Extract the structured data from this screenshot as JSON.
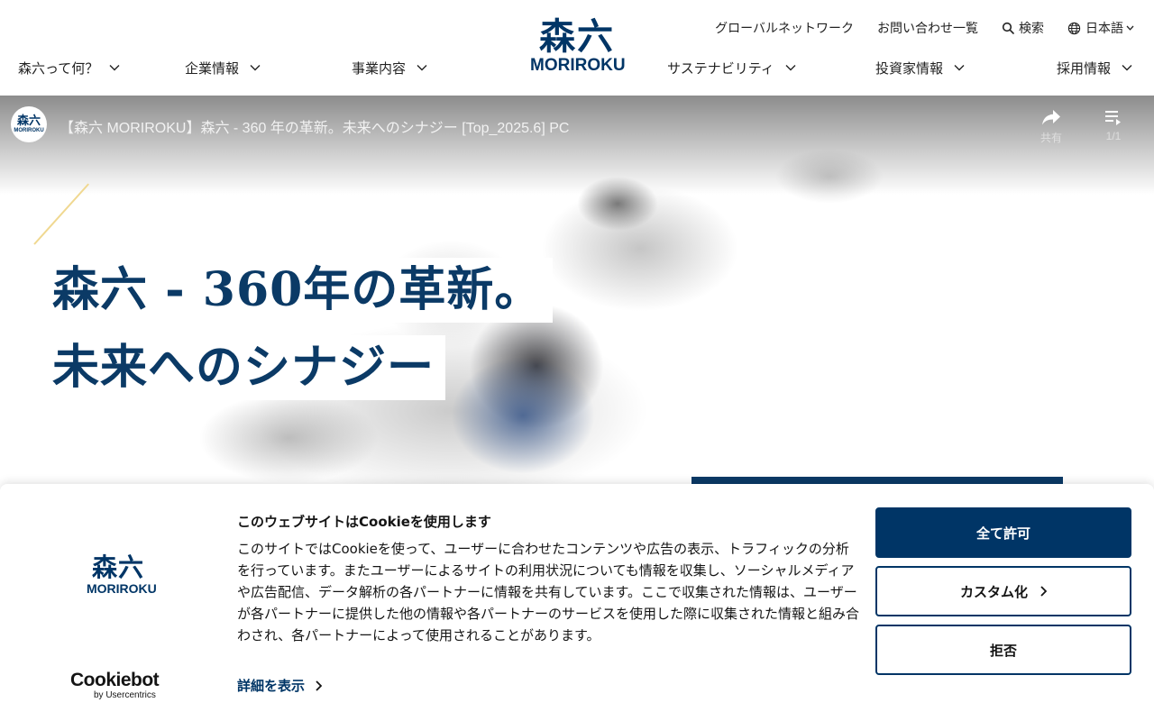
{
  "header": {
    "logo": {
      "kanji": "森六",
      "latin": "MORIROKU"
    },
    "utility_nav": {
      "global_network": "グローバルネットワーク",
      "contact": "お問い合わせ一覧",
      "search": "検索",
      "language": "日本語"
    },
    "main_nav": [
      {
        "label": "森六って何？"
      },
      {
        "label": "企業情報"
      },
      {
        "label": "事業内容"
      },
      {
        "label": "サステナビリティ"
      },
      {
        "label": "投資家情報"
      },
      {
        "label": "採用情報"
      }
    ],
    "icons": {
      "search": "search-icon",
      "language": "globe-icon",
      "dropdown": "chevron-down-icon"
    }
  },
  "video": {
    "title": "【森六 MORIROKU】森六 - 360 年の革新。未来へのシナジー [Top_2025.6] PC",
    "channel": {
      "kanji": "森六",
      "latin": "MORIROKU"
    },
    "share_label": "共有",
    "playlist_counter": "1/1",
    "icons": {
      "share": "share-icon",
      "playlist": "playlist-icon"
    }
  },
  "hero": {
    "headline_line1": "森六 - 360年の革新。",
    "headline_line2": "未来へのシナジー",
    "colors": {
      "headline": "#0b3a66",
      "accent_line": "#f0d890"
    }
  },
  "cookie_banner": {
    "logo": {
      "kanji": "森六",
      "latin": "MORIROKU"
    },
    "title": "このウェブサイトはCookieを使用します",
    "body": "このサイトではCookieを使って、ユーザーに合わせたコンテンツや広告の表示、トラフィックの分析を行っています。またユーザーによるサイトの利用状況についても情報を収集し、ソーシャルメディアや広告配信、データ解析の各パートナーに情報を共有しています。ここで収集された情報は、ユーザーが各パートナーに提供した他の情報や各パートナーのサービスを使用した際に収集された情報と組み合わされ、各パートナーによって使用されることがあります。",
    "details_link": "詳細を表示",
    "buttons": {
      "allow_all": "全て許可",
      "customize": "カスタム化",
      "deny": "拒否"
    },
    "provider": {
      "name": "Cookiebot",
      "by": "by Usercentrics"
    },
    "colors": {
      "primary": "#003566"
    }
  }
}
